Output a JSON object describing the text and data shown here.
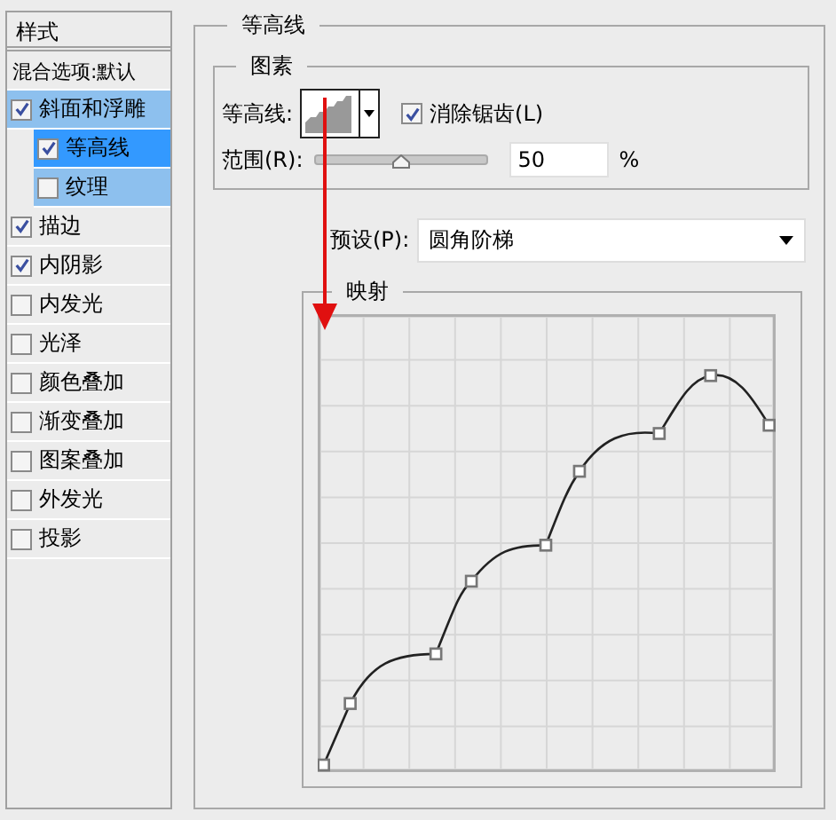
{
  "styles_panel": {
    "header": "样式",
    "blending_options": "混合选项:默认",
    "items": [
      {
        "label": "斜面和浮雕",
        "checked": true,
        "expanded": true,
        "selected": false,
        "children": [
          {
            "label": "等高线",
            "checked": true,
            "selected": true
          },
          {
            "label": "纹理",
            "checked": false,
            "selected": false
          }
        ]
      },
      {
        "label": "描边",
        "checked": true,
        "selected": false
      },
      {
        "label": "内阴影",
        "checked": true,
        "selected": false
      },
      {
        "label": "内发光",
        "checked": false,
        "selected": false
      },
      {
        "label": "光泽",
        "checked": false,
        "selected": false
      },
      {
        "label": "颜色叠加",
        "checked": false,
        "selected": false
      },
      {
        "label": "渐变叠加",
        "checked": false,
        "selected": false
      },
      {
        "label": "图案叠加",
        "checked": false,
        "selected": false
      },
      {
        "label": "外发光",
        "checked": false,
        "selected": false
      },
      {
        "label": "投影",
        "checked": false,
        "selected": false
      }
    ]
  },
  "contour_section": {
    "title": "等高线",
    "elements": {
      "title": "图素",
      "contour_label": "等高线:",
      "anti_alias": {
        "label": "消除锯齿(L)",
        "checked": true
      },
      "range": {
        "label": "范围(R):",
        "level": 0.5,
        "value": "50",
        "unit": "%"
      }
    },
    "preset": {
      "label": "预设(P):",
      "value": "圆角阶梯"
    },
    "mapping": {
      "title": "映射"
    }
  }
}
